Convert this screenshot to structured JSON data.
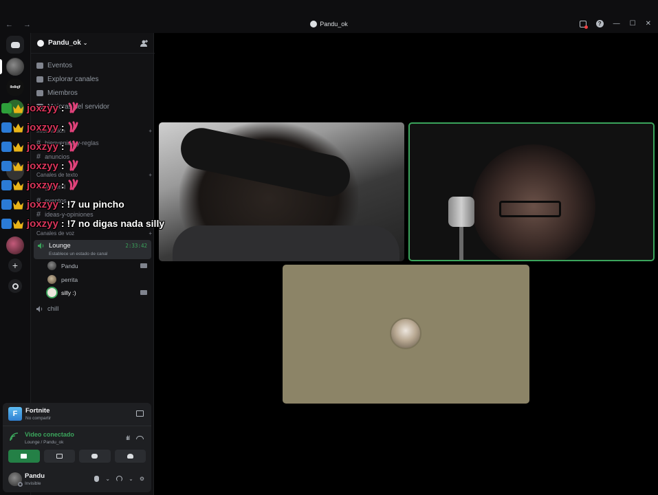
{
  "titlebar": {
    "title": "Pandu_ok",
    "nav": "← →",
    "help": "?",
    "minimize": "—",
    "maximize": "☐",
    "close": "✕"
  },
  "rail": {
    "server2_label": "ibdiqjf"
  },
  "server": {
    "name": "Pandu_ok",
    "menu": [
      "Eventos",
      "Explorar canales",
      "Miembros",
      "Mejoras del servidor"
    ]
  },
  "channels": {
    "info_category": "Información",
    "info_channels": [
      "bienvenida-y-reglas",
      "anuncios"
    ],
    "text_category": "Canales de texto",
    "text_channels": [
      "general",
      "eventos",
      "ideas-y-opiniones"
    ],
    "voice_category": "Canales de voz",
    "active_voice": {
      "name": "Lounge",
      "timer": "2:33:42",
      "status_placeholder": "Establece un estado de canal"
    },
    "members": [
      "Pandu",
      "perrita",
      "silly :)"
    ],
    "other_voice": "chill"
  },
  "panel": {
    "game_name": "Fortnite",
    "game_status": "No compartir",
    "game_icon_letter": "F",
    "voice_title": "Video conectado",
    "voice_path": "Lounge / Pandu_ok",
    "user_name": "Pandu",
    "user_status": "Invisible"
  },
  "overlay": {
    "messages": [
      {
        "user": "joxzyy",
        "sep": ":",
        "text": ""
      },
      {
        "user": "joxzyy",
        "sep": ":",
        "text": ""
      },
      {
        "user": "joxzyy",
        "sep": ":",
        "text": ""
      },
      {
        "user": "joxzyy",
        "sep": ":",
        "text": ""
      },
      {
        "user": "joxzyy",
        "sep": ":",
        "text": ""
      },
      {
        "user": "joxzyy",
        "sep": ":",
        "text": "!7 uu pincho"
      },
      {
        "user": "joxzyy",
        "sep": ":",
        "text": "!7 no digas nada silly"
      }
    ]
  },
  "colors": {
    "accent_green": "#3ba55c",
    "overlay_name": "#d7355a",
    "emote_pink": "#e0427a"
  }
}
